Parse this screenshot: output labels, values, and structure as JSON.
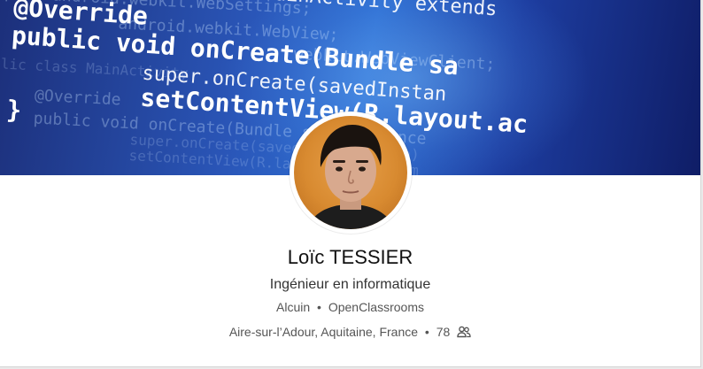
{
  "profile": {
    "name": "Loïc TESSIER",
    "headline": "Ingénieur en informatique",
    "school": "Alcuin",
    "company": "OpenClassrooms",
    "location": "Aire-sur-l’Adour, Aquitaine, France",
    "connections": "78",
    "separator": "•"
  },
  "banner": {
    "code_lines": {
      "l1": "ss MainActivity extends",
      "l2": "@Override",
      "l3": "public void onCreate(Bundle sa",
      "l4": "super.onCreate(savedInstan",
      "l5": "setContentView(R.layout.ac",
      "l6": "}",
      "f1": "port android.webkit.WebSettings;",
      "f2": "android.webkit.WebView;",
      "f3": "webkit.WebViewClient;",
      "f4": "lic class MainActivity",
      "f5": "@Override",
      "f6": "public void onCreate(Bundle savedInstance",
      "f7": "super.onCreate(savedInstanceState)",
      "f8": "setContentView(R.layout.activity_m"
    }
  },
  "icons": {
    "connections": "people-icon"
  },
  "colors": {
    "banner_dark": "#0f1d66",
    "banner_light": "#2f6fd2",
    "name_text": "#111111",
    "secondary_text": "#555555"
  }
}
